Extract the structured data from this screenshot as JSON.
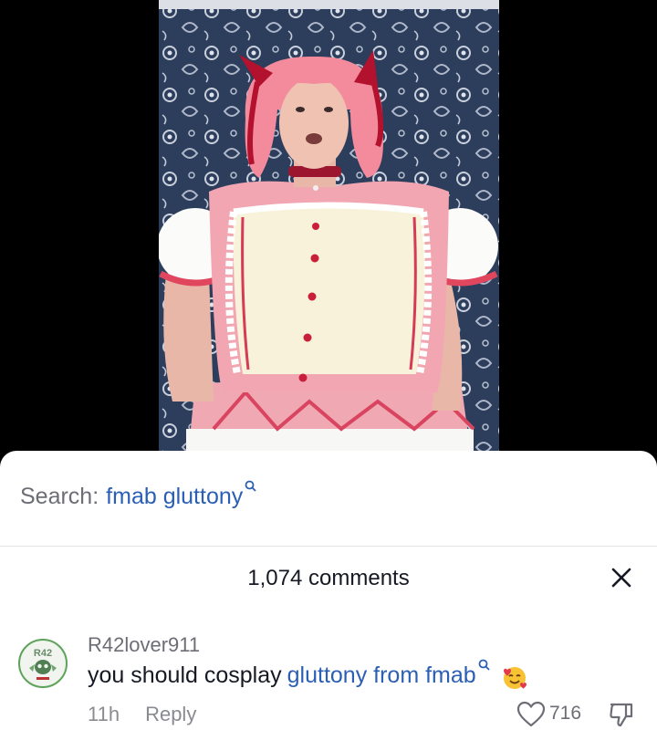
{
  "video": {
    "description_icon": "cosplay-video-frame"
  },
  "search": {
    "label": "Search:",
    "term": "fmab gluttony",
    "icon": "search-icon"
  },
  "comments": {
    "header": "1,074 comments",
    "close_icon": "close-icon"
  },
  "comment": {
    "username": "R42lover911",
    "text": "you should cosplay",
    "link_text": "gluttony from fmab",
    "emoji": "smiling-face-with-hearts",
    "time": "11h",
    "reply_label": "Reply",
    "likes": "716"
  },
  "colors": {
    "link": "#2b5fb3",
    "muted": "#8a8b91",
    "text": "#161823"
  }
}
